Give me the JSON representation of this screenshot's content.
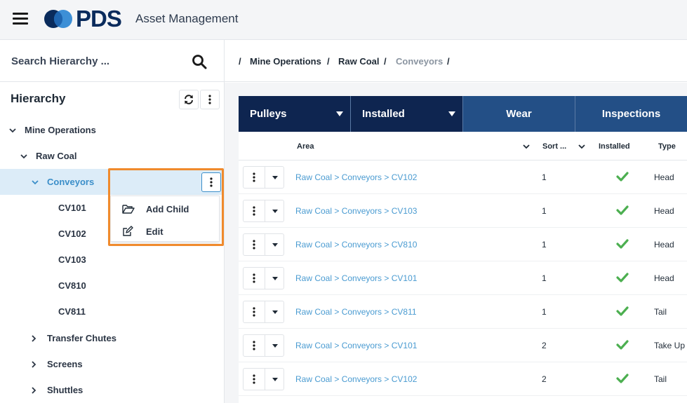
{
  "header": {
    "logo_text": "PDS",
    "app_title": "Asset Management"
  },
  "colors": {
    "navy": "#0e2550",
    "tab_blue": "#234f86",
    "link": "#4a9bd1",
    "check": "#4caf50",
    "highlight": "#f08a2c"
  },
  "sidebar": {
    "search_placeholder": "Search Hierarchy ...",
    "hierarchy_title": "Hierarchy",
    "tree": [
      {
        "label": "Mine Operations",
        "expanded": true
      },
      {
        "label": "Raw Coal",
        "expanded": true
      },
      {
        "label": "Conveyors",
        "expanded": true,
        "selected": true
      },
      {
        "label": "CV101"
      },
      {
        "label": "CV102"
      },
      {
        "label": "CV103"
      },
      {
        "label": "CV810"
      },
      {
        "label": "CV811"
      },
      {
        "label": "Transfer Chutes",
        "expanded": false
      },
      {
        "label": "Screens",
        "expanded": false
      },
      {
        "label": "Shuttles",
        "expanded": false
      }
    ],
    "context_menu": [
      {
        "label": "Add Child",
        "icon": "folder-open-icon"
      },
      {
        "label": "Edit",
        "icon": "edit-icon"
      }
    ]
  },
  "breadcrumb": {
    "items": [
      "Mine Operations",
      "Raw Coal",
      "Conveyors"
    ],
    "separator": "/"
  },
  "tabs": [
    {
      "label": "Pulleys",
      "dropdown": true
    },
    {
      "label": "Installed",
      "dropdown": true
    },
    {
      "label": "Wear"
    },
    {
      "label": "Inspections"
    }
  ],
  "table": {
    "columns": {
      "area": "Area",
      "sort": "Sort ...",
      "installed": "Installed",
      "type": "Type"
    },
    "rows": [
      {
        "area": "Raw Coal > Conveyors > CV102",
        "sort": "1",
        "installed": true,
        "type": "Head"
      },
      {
        "area": "Raw Coal > Conveyors > CV103",
        "sort": "1",
        "installed": true,
        "type": "Head"
      },
      {
        "area": "Raw Coal > Conveyors > CV810",
        "sort": "1",
        "installed": true,
        "type": "Head"
      },
      {
        "area": "Raw Coal > Conveyors > CV101",
        "sort": "1",
        "installed": true,
        "type": "Head"
      },
      {
        "area": "Raw Coal > Conveyors > CV811",
        "sort": "1",
        "installed": true,
        "type": "Tail"
      },
      {
        "area": "Raw Coal > Conveyors > CV101",
        "sort": "2",
        "installed": true,
        "type": "Take Up"
      },
      {
        "area": "Raw Coal > Conveyors > CV102",
        "sort": "2",
        "installed": true,
        "type": "Tail"
      }
    ]
  }
}
